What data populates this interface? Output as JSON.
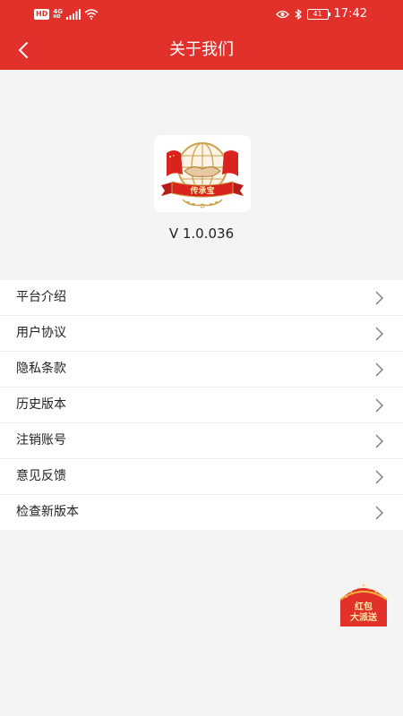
{
  "status_bar": {
    "hd_badge": "HD",
    "network_top": "4G",
    "network_bottom": "HD",
    "battery_level": "41",
    "time": "17:42",
    "icons": [
      "signal-icon",
      "wifi-icon",
      "eye-icon",
      "bluetooth-icon",
      "battery-icon"
    ]
  },
  "nav": {
    "title": "关于我们",
    "back_icon": "chevron-left-icon"
  },
  "app": {
    "logo_text": "传承宝",
    "version": "V 1.0.036"
  },
  "menu": {
    "items": [
      {
        "label": "平台介绍"
      },
      {
        "label": "用户协议"
      },
      {
        "label": "隐私条款"
      },
      {
        "label": "历史版本"
      },
      {
        "label": "注销账号"
      },
      {
        "label": "意见反馈"
      },
      {
        "label": "检查新版本"
      }
    ]
  },
  "promo": {
    "line1": "红包",
    "line2": "大派送"
  },
  "colors": {
    "brand_red": "#e2312b",
    "gold": "#c9a24a",
    "background": "#f4f4f4"
  }
}
